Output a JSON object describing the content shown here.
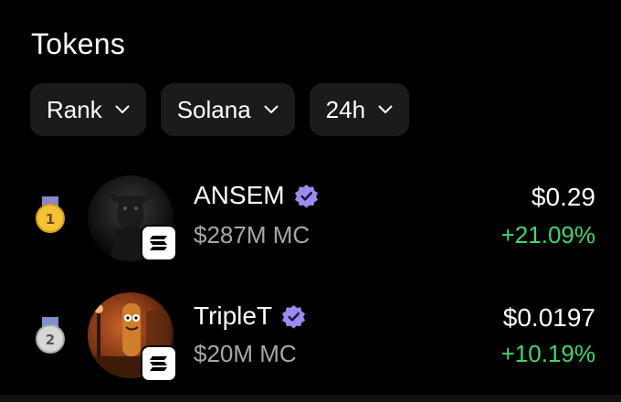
{
  "header": {
    "title": "Tokens"
  },
  "filters": [
    {
      "label": "Rank"
    },
    {
      "label": "Solana"
    },
    {
      "label": "24h"
    }
  ],
  "tokens": [
    {
      "rank": "1",
      "name": "ANSEM",
      "market_cap": "$287M MC",
      "price": "$0.29",
      "change": "+21.09%",
      "medal": "gold-medal-icon",
      "chain": "solana-icon"
    },
    {
      "rank": "2",
      "name": "TripleT",
      "market_cap": "$20M MC",
      "price": "$0.0197",
      "change": "+10.19%",
      "medal": "silver-medal-icon",
      "chain": "solana-icon"
    }
  ],
  "colors": {
    "background": "#000000",
    "chip": "#1b1b1e",
    "muted_text": "#a7a7ab",
    "positive": "#3fd86c",
    "verified": "#9b8cf0"
  }
}
